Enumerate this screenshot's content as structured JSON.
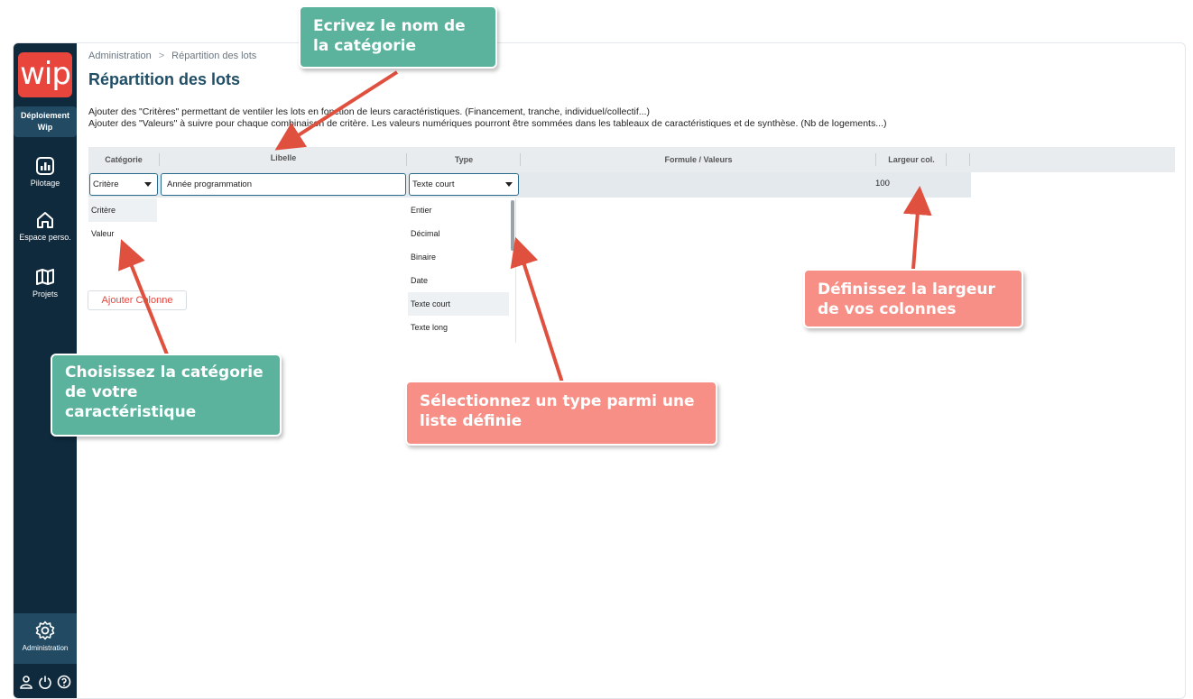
{
  "sidebar": {
    "logo": "wip",
    "deploy_line1": "Déploiement",
    "deploy_line2": "Wip",
    "items": [
      {
        "label": "Pilotage",
        "icon": "chart-icon"
      },
      {
        "label": "Espace perso.",
        "icon": "home-icon"
      },
      {
        "label": "Projets",
        "icon": "map-icon"
      }
    ],
    "admin_label": "Administration",
    "bottom_icons": [
      "user-icon",
      "power-icon",
      "help-icon"
    ]
  },
  "breadcrumb": {
    "root": "Administration",
    "current": "Répartition des lots"
  },
  "page_title": "Répartition des lots",
  "description": {
    "line1": "Ajouter des \"Critères\" permettant de ventiler les lots en fonction de leurs caractéristiques. (Financement, tranche, individuel/collectif...)",
    "line2": "Ajouter des \"Valeurs\" à suivre pour chaque combinaison de critère. Les valeurs numériques pourront être sommées dans les tableaux de caractéristiques et de synthèse. (Nb de logements...)"
  },
  "grid": {
    "headers": {
      "categorie": "Catégorie",
      "libelle": "Libelle",
      "type": "Type",
      "formule": "Formule / Valeurs",
      "largeur": "Largeur col."
    },
    "row": {
      "categorie": "Critère",
      "libelle": "Année programmation",
      "type": "Texte court",
      "largeur": "100"
    }
  },
  "category_options": [
    "Critère",
    "Valeur"
  ],
  "type_options": [
    "Entier",
    "Décimal",
    "Binaire",
    "Date",
    "Texte court",
    "Texte long"
  ],
  "add_column_label": "Ajouter Colonne",
  "callouts": {
    "name": {
      "line1": "Ecrivez le nom de",
      "line2": "la catégorie"
    },
    "category": {
      "line1": "Choisissez la catégorie",
      "line2": "de votre",
      "line3": "caractéristique"
    },
    "type": {
      "line1": "Sélectionnez un type parmi une",
      "line2": "liste définie"
    },
    "width": {
      "line1": "Définissez la largeur",
      "line2": "de vos colonnes"
    }
  },
  "colors": {
    "sidebar": "#0f2a3d",
    "brand": "#e8453c",
    "title": "#1f4e66",
    "callout_green": "#5cb39d",
    "callout_salmon": "#f78f86",
    "arrow": "#e0503f"
  }
}
